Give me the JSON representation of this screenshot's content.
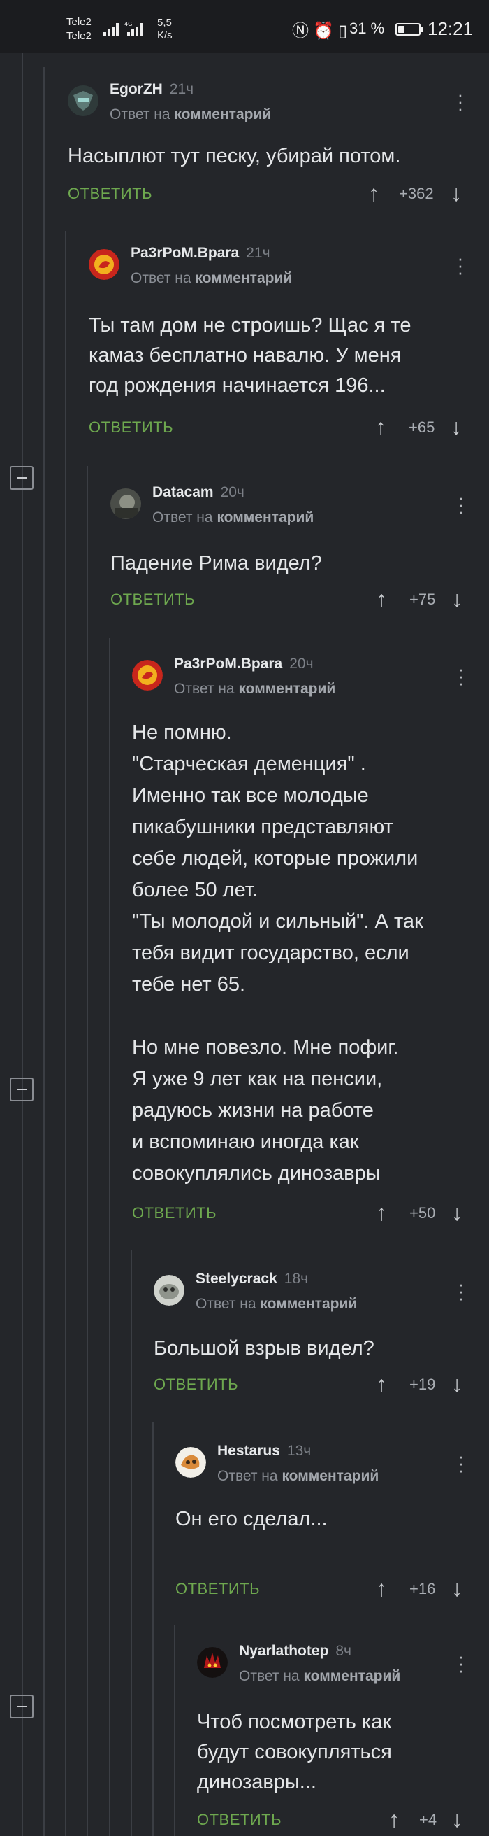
{
  "status_bar": {
    "carrier1": "Tele2",
    "carrier2": "Tele2",
    "network": "4G",
    "speed_value": "5,5",
    "speed_unit": "K/s",
    "battery_pct": "31 %",
    "battery_level": 0.31,
    "time": "12:21"
  },
  "icons": {
    "upvote": "arrow-up-icon",
    "downvote": "arrow-down-icon",
    "menu": "more-vertical-icon",
    "collapse": "collapse-minus-icon"
  },
  "colors": {
    "background": "#24262a",
    "reply_accent": "#6ea84f",
    "thread_line": "#3b3e44"
  },
  "comments": [
    {
      "username": "EgorZH",
      "time": "21ч",
      "reply_prefix": "Ответ на",
      "reply_target": "комментарий",
      "body": "Насыплют тут песку, убирай потом.",
      "reply_label": "ОТВЕТИТЬ",
      "votes": "+362"
    },
    {
      "username": "Pa3rPoM.Bpara",
      "time": "21ч",
      "reply_prefix": "Ответ на",
      "reply_target": "комментарий",
      "body": "Ты там дом не строишь? Щас я те\nкамаз бесплатно навалю. У меня\nгод рождения начинается 196...",
      "reply_label": "ОТВЕТИТЬ",
      "votes": "+65"
    },
    {
      "username": "Datacam",
      "time": "20ч",
      "reply_prefix": "Ответ на",
      "reply_target": "комментарий",
      "body": "Падение Рима видел?",
      "reply_label": "ОТВЕТИТЬ",
      "votes": "+75"
    },
    {
      "username": "Pa3rPoM.Bpara",
      "time": "20ч",
      "reply_prefix": "Ответ на",
      "reply_target": "комментарий",
      "body": "Не помню.\n \"Старческая деменция\" .\nИменно так все молодые\nпикабушники представляют\nсебе людей, которые прожили\nболее 50 лет.\n\"Ты молодой и сильный\". А так\nтебя видит государство, если\nтебе нет 65.\n\nНо мне повезло. Мне пофиг.\nЯ уже 9 лет как на пенсии,\nрадуюсь жизни на работе\nи вспоминаю иногда как\nсовокуплялись динозавры",
      "reply_label": "ОТВЕТИТЬ",
      "votes": "+50"
    },
    {
      "username": "Steelycrack",
      "time": "18ч",
      "reply_prefix": "Ответ на",
      "reply_target": "комментарий",
      "body": "Большой взрыв видел?",
      "reply_label": "ОТВЕТИТЬ",
      "votes": "+19"
    },
    {
      "username": "Hestarus",
      "time": "13ч",
      "reply_prefix": "Ответ на",
      "reply_target": "комментарий",
      "body": "Он его сделал...",
      "reply_label": "ОТВЕТИТЬ",
      "votes": "+16"
    },
    {
      "username": "Nyarlathotep",
      "time": "8ч",
      "reply_prefix": "Ответ на",
      "reply_target": "комментарий",
      "body": "Чтоб посмотреть как\nбудут совокупляться\nдинозавры...",
      "reply_label": "ОТВЕТИТЬ",
      "votes": "+4"
    }
  ]
}
